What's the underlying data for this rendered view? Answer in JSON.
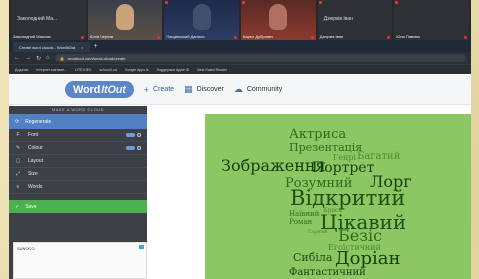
{
  "video_call": {
    "tiles": [
      {
        "name": "Заколодний  Ма...",
        "layout": "label"
      },
      {
        "name": "Юлія Черпак",
        "layout": "person",
        "color": "#c9a27a"
      },
      {
        "name": "Пащинський Данило",
        "layout": "person",
        "color": "#2a3350"
      },
      {
        "name": "Карел Дубрович",
        "layout": "person",
        "color": "#6e2f2a"
      },
      {
        "name": "Дзюрків Іван",
        "layout": "label"
      },
      {
        "name": "Юля Павлюк",
        "layout": "dark"
      }
    ],
    "extra_labels": [
      "Заколодний Максим",
      "Дзюрків Іван"
    ]
  },
  "browser": {
    "tab_title": "Create word clouds - WordItOut",
    "tab_close": "×",
    "new_tab": "+",
    "nav": [
      "←",
      "→",
      "↻",
      "⌂"
    ],
    "url": "worditout.com/word-cloud/create",
    "bookmarks": [
      "Додатки",
      "Інтернет-магазин...",
      "LITE.KIEV",
      "school.il.ua",
      "Google Apps Is",
      "Поддержка Apple ID",
      "Best Rated Reader"
    ]
  },
  "header": {
    "logo_word": "Word",
    "logo_it": "ItOut",
    "nav": [
      {
        "icon": "+",
        "label": "Create"
      },
      {
        "icon": "▦",
        "label": "Discover"
      },
      {
        "icon": "☁",
        "label": "Community"
      }
    ]
  },
  "sidebar": {
    "title": "MAKE A WORD CLOUD",
    "regenerate": "Regenerate",
    "items": [
      {
        "label": "Font",
        "icon": "F"
      },
      {
        "label": "Colour",
        "icon": "✎"
      },
      {
        "label": "Layout",
        "icon": "▢"
      },
      {
        "label": "Size",
        "icon": "⤢"
      },
      {
        "label": "Words",
        "icon": "≡"
      }
    ],
    "save": "Save",
    "ad_code": "SUNOCO"
  },
  "cloud": {
    "background": "#8cc763",
    "words": [
      {
        "text": "Актриса",
        "color": "#2f6b1d"
      },
      {
        "text": "Презентація",
        "color": "#2f6b1d"
      },
      {
        "text": "Генрі",
        "color": "#4d8a2e"
      },
      {
        "text": "Багатий",
        "color": "#4d8a2e"
      },
      {
        "text": "Зображення",
        "color": "#173d0c"
      },
      {
        "text": "Портрет",
        "color": "#173d0c"
      },
      {
        "text": "Розумний",
        "color": "#2f6b1d"
      },
      {
        "text": "Лорг",
        "color": "#173d0c"
      },
      {
        "text": "Відкритий",
        "color": "#1f4f13"
      },
      {
        "text": "Наївний",
        "color": "#2f6b1d"
      },
      {
        "text": "Краса",
        "color": "#4d8a2e"
      },
      {
        "text": "Роман",
        "color": "#2f6b1d"
      },
      {
        "text": "Цікавий",
        "color": "#1f4f13"
      },
      {
        "text": "Гарний",
        "color": "#4d8a2e"
      },
      {
        "text": "Безіс",
        "color": "#2f6b1d"
      },
      {
        "text": "Егоїстичний",
        "color": "#4d8a2e"
      },
      {
        "text": "Сибіла",
        "color": "#1f4f13"
      },
      {
        "text": "Доріан",
        "color": "#173d0c"
      },
      {
        "text": "Фантастичний",
        "color": "#173d0c"
      }
    ]
  }
}
